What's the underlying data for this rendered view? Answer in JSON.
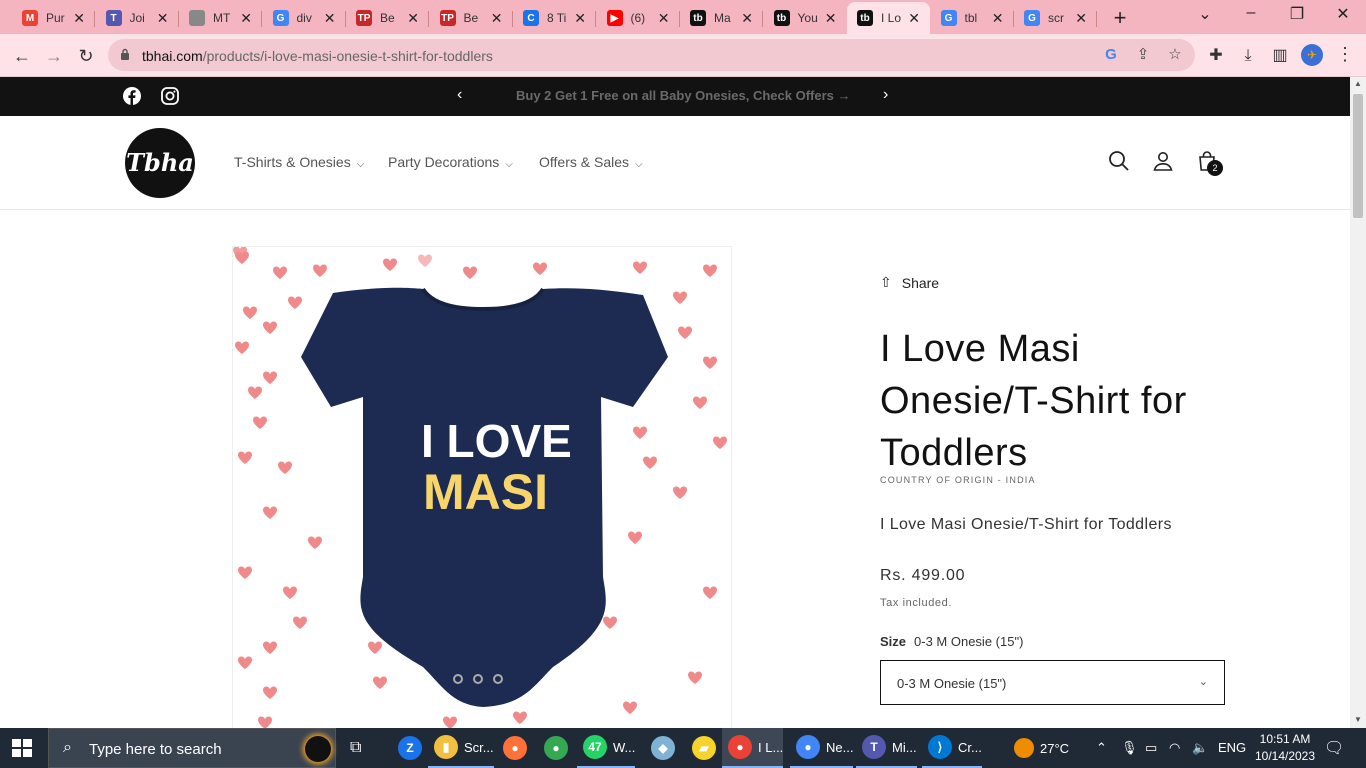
{
  "browser": {
    "tabs": [
      {
        "title": "Pur",
        "fav": "M",
        "color": "#ea4335"
      },
      {
        "title": "Joi",
        "fav": "T",
        "color": "#5558af"
      },
      {
        "title": "MT",
        "fav": "",
        "color": "#888888"
      },
      {
        "title": "div",
        "fav": "G",
        "color": "#4285f4"
      },
      {
        "title": "Be",
        "fav": "TP",
        "color": "#c62828"
      },
      {
        "title": "Be",
        "fav": "TP",
        "color": "#c62828"
      },
      {
        "title": "8 Ti",
        "fav": "C",
        "color": "#1a73e8"
      },
      {
        "title": "(6)",
        "fav": "▶",
        "color": "#ff0000"
      },
      {
        "title": "Ma",
        "fav": "tb",
        "color": "#111111"
      },
      {
        "title": "You",
        "fav": "tb",
        "color": "#111111"
      },
      {
        "title": "I Lo",
        "fav": "tb",
        "color": "#111111"
      },
      {
        "title": "tbl",
        "fav": "G",
        "color": "#4285f4"
      },
      {
        "title": "scr",
        "fav": "G",
        "color": "#4285f4"
      }
    ],
    "active_tab_index": 10,
    "url_host": "tbhai.com",
    "url_path": "/products/i-love-masi-onesie-t-shirt-for-toddlers",
    "icons": [
      "back-arrow-icon",
      "forward-arrow-icon",
      "reload-icon",
      "lock-icon",
      "google-lens-icon",
      "share-icon",
      "bookmark-star-icon",
      "extensions-icon",
      "download-icon",
      "side-panel-icon",
      "profile-avatar-icon",
      "kebab-menu-icon"
    ]
  },
  "announcement": {
    "message": "Buy 2 Get 1 Free on all Baby Onesies, Check Offers →",
    "prev": "‹",
    "next": "›"
  },
  "header": {
    "logo_text": "Tbha",
    "menu": [
      {
        "label": "T-Shirts & Onesies"
      },
      {
        "label": "Party Decorations"
      },
      {
        "label": "Offers & Sales"
      }
    ],
    "cart_count": "2"
  },
  "product": {
    "share_label": "Share",
    "title": "I Love Masi Onesie/T-Shirt for Toddlers",
    "origin": "COUNTRY OF ORIGIN - INDIA",
    "description": "I Love Masi Onesie/T-Shirt for Toddlers",
    "price": "Rs. 499.00",
    "tax_note": "Tax included.",
    "size_label": "Size",
    "size_selected": "0-3 M Onesie (15\")",
    "image_print_line1": "I LOVE",
    "image_print_line2": "MASI",
    "colors": {
      "onesie": "#1d2b52",
      "heart": "#f08a8a",
      "text_yellow": "#f7d56b"
    }
  },
  "taskbar": {
    "search_placeholder": "Type here to search",
    "apps": [
      {
        "label": "",
        "color": "#1a73e8",
        "icon": "Z"
      },
      {
        "label": "Scr...",
        "color": "#f0c040",
        "icon": "▮"
      },
      {
        "label": "",
        "color": "#ff7139",
        "icon": "●"
      },
      {
        "label": "",
        "color": "#34a853",
        "icon": "●"
      },
      {
        "label": "W...",
        "color": "#25d366",
        "icon": "47"
      },
      {
        "label": "",
        "color": "#7fb3d5",
        "icon": "◆"
      },
      {
        "label": "",
        "color": "#f7d32b",
        "icon": "▰"
      },
      {
        "label": "I L...",
        "color": "#ea4335",
        "icon": "●"
      },
      {
        "label": "Ne...",
        "color": "#4285f4",
        "icon": "●"
      },
      {
        "label": "Mi...",
        "color": "#5558af",
        "icon": "T"
      },
      {
        "label": "Cr...",
        "color": "#0078d4",
        "icon": "⟩"
      }
    ],
    "weather": "27°C",
    "language": "ENG",
    "time": "10:51 AM",
    "date": "10/14/2023"
  }
}
